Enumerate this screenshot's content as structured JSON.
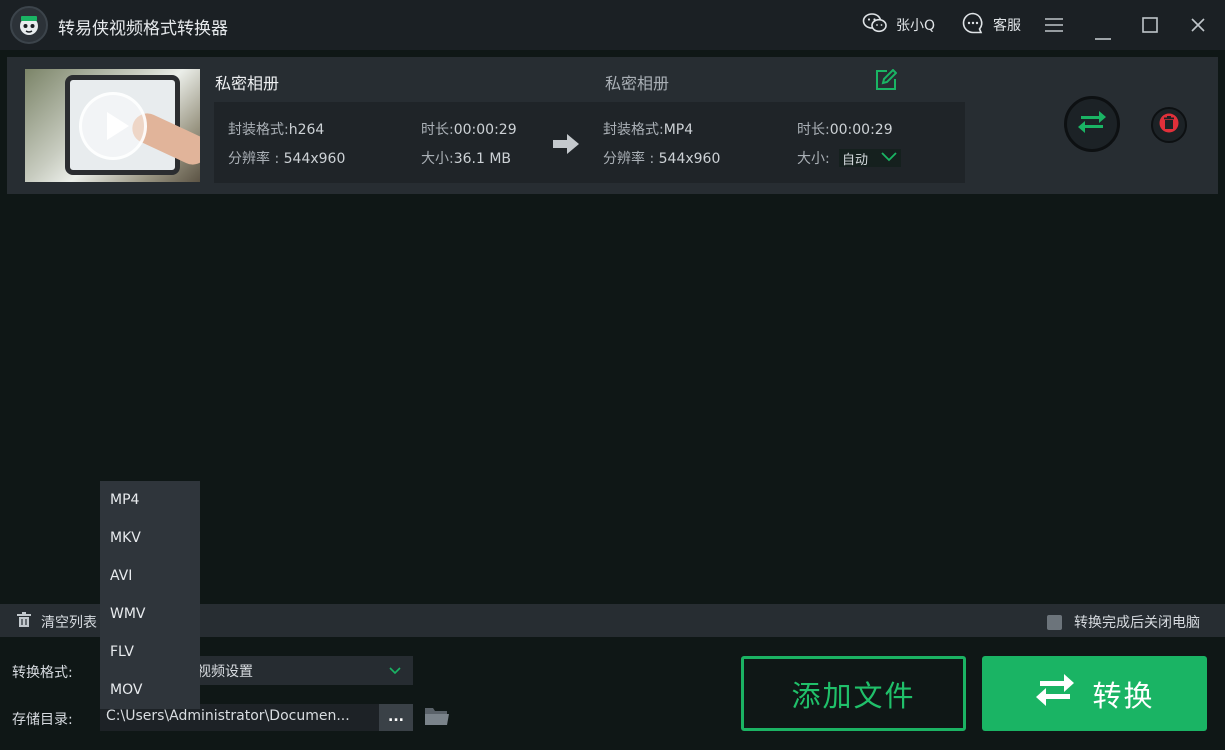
{
  "app": {
    "title": "转易侠视频格式转换器",
    "user_name": "张小Q",
    "support_label": "客服"
  },
  "colors": {
    "accent": "#1ab464",
    "background": "#0f1716",
    "panel": "#272d32",
    "delete": "#e0303a"
  },
  "file": {
    "source_name": "私密相册",
    "target_name": "私密相册",
    "source": {
      "container_label": "封装格式:",
      "container": "h264",
      "resolution_label": "分辨率 :",
      "resolution": "544x960",
      "duration_label": "时长:",
      "duration": "00:00:29",
      "size_label": "大小:",
      "size": "36.1 MB"
    },
    "target": {
      "container_label": "封装格式:",
      "container": "MP4",
      "resolution_label": "分辨率 :",
      "resolution": "544x960",
      "duration_label": "时长:",
      "duration": "00:00:29",
      "size_label": "大小:",
      "size": "自动"
    }
  },
  "toolbar": {
    "clear_list": "清空列表",
    "shutdown_after": "转换完成后关闭电脑"
  },
  "settings": {
    "format_label": "转换格式:",
    "format_value": "视频设置",
    "output_label": "存储目录:",
    "output_path": "C:\\Users\\Administrator\\Documen...",
    "browse_label": "..."
  },
  "actions": {
    "add_file": "添加文件",
    "convert": "转换"
  },
  "format_options": [
    "MP4",
    "MKV",
    "AVI",
    "WMV",
    "FLV",
    "MOV"
  ],
  "icons": [
    "app-logo-icon",
    "wechat-icon",
    "chat-bubble-icon",
    "menu-icon",
    "minimize-icon",
    "maximize-icon",
    "close-icon",
    "play-icon",
    "edit-icon",
    "arrow-right-icon",
    "chevron-down-icon",
    "convert-icon",
    "trash-icon",
    "folder-icon"
  ]
}
